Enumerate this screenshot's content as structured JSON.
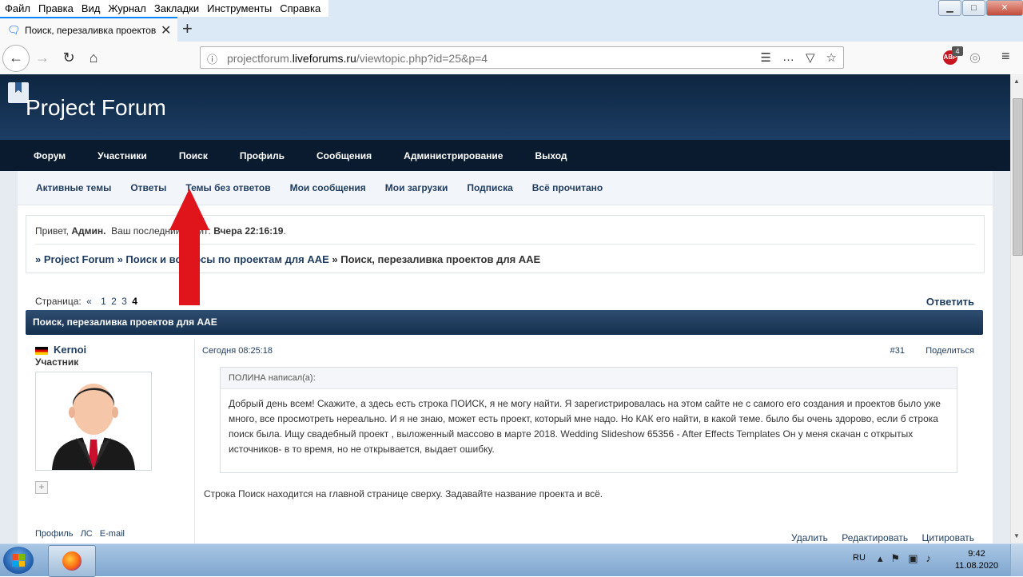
{
  "browser": {
    "menu": [
      "Файл",
      "Правка",
      "Вид",
      "Журнал",
      "Закладки",
      "Инструменты",
      "Справка"
    ],
    "tab_title": "Поиск, перезаливка проектов",
    "url_prefix": "projectforum.",
    "url_domain": "liveforums.ru",
    "url_path": "/viewtopic.php?id=25&p=4",
    "addon_badge": "4",
    "addon_label": "ABP"
  },
  "forum": {
    "title": "Project Forum",
    "main_nav": [
      "Форум",
      "Участники",
      "Поиск",
      "Профиль",
      "Сообщения",
      "Администрирование",
      "Выход"
    ],
    "sub_nav": [
      "Активные темы",
      "Ответы",
      "Темы без ответов",
      "Мои сообщения",
      "Мои загрузки",
      "Подписка",
      "Всё прочитано"
    ],
    "welcome": {
      "greeting": "Привет,",
      "user": "Админ.",
      "last_visit_label": "Ваш последний визит:",
      "last_visit": "Вчера 22:16:19",
      "dot": "."
    },
    "breadcrumb": {
      "home": "» Project Forum",
      "section": "» Поиск и вопросы по проектам для AAE",
      "current": "» Поиск, перезаливка проектов для AAE"
    },
    "pages": {
      "label": "Страница:",
      "prev": "«",
      "links": [
        "1",
        "2",
        "3"
      ],
      "current": "4"
    },
    "reply_label": "Ответить",
    "topic_title": "Поиск, перезаливка проектов для AAE",
    "post": {
      "author": "Kernoi",
      "rank": "Участник",
      "date": "Сегодня 08:25:18",
      "number": "#31",
      "share": "Поделиться",
      "quote_header": "ПОЛИНА написал(а):",
      "quote_text": "Добрый день всем! Скажите, а здесь есть строка ПОИСК, я не могу найти.  Я зарегистрировалась на этом сайте не с самого его создания и проектов было уже много, все просмотреть нереально. И я не знаю, может есть проект, который мне надо. Но КАК его найти, в какой теме. было бы очень здорово, если б строка поиск была. Ищу  свадебный проект , выложенный массово в марте 2018.   Wedding Slideshow 65356 - After Effects Templates Он у меня скачан с открытых источников- в то время, но не открывается, выдает ошибку.",
      "reply_text": "Строка Поиск находится на главной странице сверху. Задавайте название проекта и всё.",
      "plus": "+",
      "user_links": [
        "Профиль",
        "ЛС",
        "E-mail"
      ],
      "actions": [
        "Удалить",
        "Редактировать",
        "Цитировать"
      ]
    }
  },
  "taskbar": {
    "lang": "RU",
    "time": "9:42",
    "date": "11.08.2020"
  },
  "colors": {
    "header": "#0d2540",
    "nav": "#0a1b30",
    "link": "#1f3c5f",
    "arrow": "#e0141b"
  }
}
